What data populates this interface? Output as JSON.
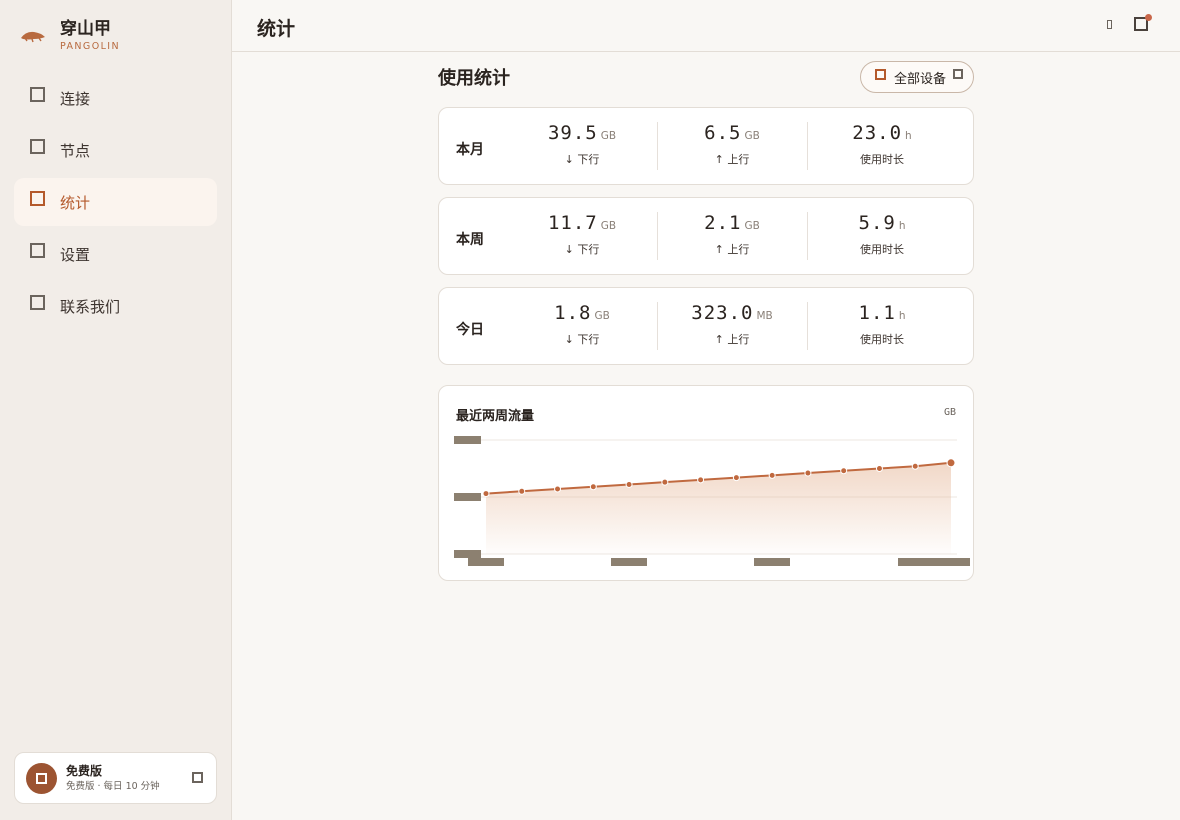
{
  "brand": {
    "name": "穿山甲",
    "subtitle": "PANGOLIN"
  },
  "sidebar": {
    "items": [
      {
        "label": "连接",
        "icon": "link-icon",
        "active": false
      },
      {
        "label": "节点",
        "icon": "server-icon",
        "active": false
      },
      {
        "label": "统计",
        "icon": "chart-icon",
        "active": true
      },
      {
        "label": "设置",
        "icon": "settings-icon",
        "active": false
      },
      {
        "label": "联系我们",
        "icon": "contact-icon",
        "active": false
      }
    ],
    "plan": {
      "title": "免费版",
      "desc": "免费版 · 每日 10 分钟"
    }
  },
  "header": {
    "title": "统计"
  },
  "main": {
    "section_title": "使用统计",
    "device_filter": "全部设备",
    "stats": [
      {
        "label": "本月",
        "down": {
          "value": "39.5",
          "unit": "GB",
          "caption": "↓ 下行"
        },
        "up": {
          "value": "6.5",
          "unit": "GB",
          "caption": "↑ 上行"
        },
        "time": {
          "value": "23.0",
          "unit": "h",
          "caption": "使用时长"
        }
      },
      {
        "label": "本周",
        "down": {
          "value": "11.7",
          "unit": "GB",
          "caption": "↓ 下行"
        },
        "up": {
          "value": "2.1",
          "unit": "GB",
          "caption": "↑ 上行"
        },
        "time": {
          "value": "5.9",
          "unit": "h",
          "caption": "使用时长"
        }
      },
      {
        "label": "今日",
        "down": {
          "value": "1.8",
          "unit": "GB",
          "caption": "↓ 下行"
        },
        "up": {
          "value": "323.0",
          "unit": "MB",
          "caption": "↑ 上行"
        },
        "time": {
          "value": "1.1",
          "unit": "h",
          "caption": "使用时长"
        }
      }
    ],
    "chart": {
      "title": "最近两周流量",
      "unit": "GB"
    }
  },
  "chart_data": {
    "type": "area",
    "title": "最近两周流量",
    "ylabel": "GB",
    "x": [
      1,
      2,
      3,
      4,
      5,
      6,
      7,
      8,
      9,
      10,
      11,
      12,
      13,
      14
    ],
    "values": [
      0.53,
      0.55,
      0.57,
      0.59,
      0.61,
      0.63,
      0.65,
      0.67,
      0.69,
      0.71,
      0.73,
      0.75,
      0.77,
      0.8
    ],
    "ylim": [
      0,
      1
    ],
    "grid": true
  },
  "colors": {
    "accent": "#b4592b",
    "line": "#c0693f",
    "area": "#e6b89a"
  }
}
